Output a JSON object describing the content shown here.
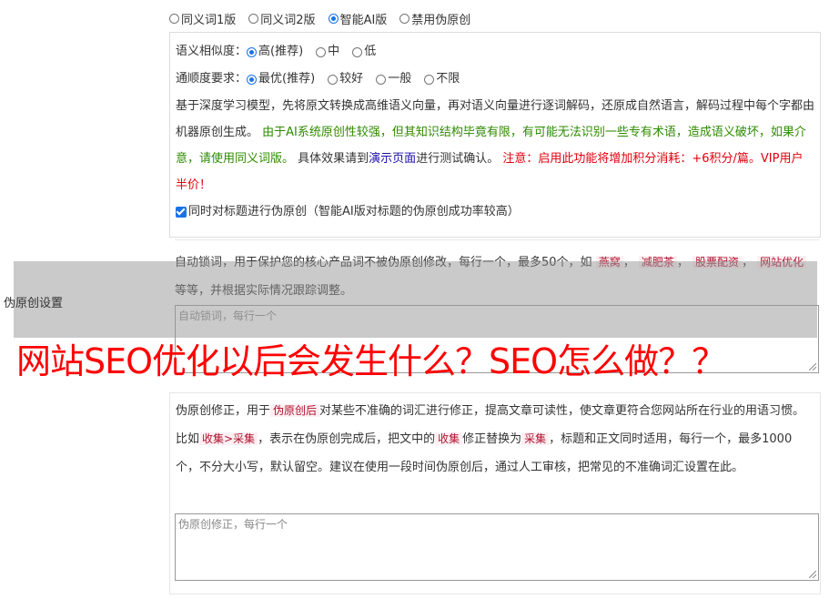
{
  "version_options": [
    {
      "label": "同义词1版",
      "checked": false
    },
    {
      "label": "同义词2版",
      "checked": false
    },
    {
      "label": "智能AI版",
      "checked": true
    },
    {
      "label": "禁用伪原创",
      "checked": false
    }
  ],
  "similarity": {
    "label": "语义相似度：",
    "options": [
      {
        "label": "高(推荐)",
        "checked": true
      },
      {
        "label": "中",
        "checked": false
      },
      {
        "label": "低",
        "checked": false
      }
    ]
  },
  "fluency": {
    "label": "通顺度要求：",
    "options": [
      {
        "label": "最优(推荐)",
        "checked": true
      },
      {
        "label": "较好",
        "checked": false
      },
      {
        "label": "一般",
        "checked": false
      },
      {
        "label": "不限",
        "checked": false
      }
    ]
  },
  "description": {
    "text1": "基于深度学习模型，先将原文转换成高维语义向量，再对语义向量进行逐词解码，还原成自然语言，解码过程中每个字都由机器原创生成。",
    "warn_green": "由于AI系统原创性较强，但其知识结构毕竟有限，有可能无法识别一些专有术语，造成语义破坏，如果介意，请使用同义词版。",
    "text2": "具体效果请到",
    "demo_link": "演示页面",
    "text3": "进行测试确认。",
    "warn_red": "注意：启用此功能将增加积分消耗：+6积分/篇。VIP用户半价！"
  },
  "title_checkbox": {
    "label": "同时对标题进行伪原创（智能AI版对标题的伪原创成功率较高）",
    "checked": true
  },
  "lock_words": {
    "text1": "自动锁词，用于保护您的核心产品词不被伪原创修改，每行一个，最多50个，如",
    "tags": [
      "燕窝",
      "减肥茶",
      "股票配资",
      "网站优化"
    ],
    "text2": "等等，并根据实际情况跟踪调整。",
    "placeholder": "自动锁词，每行一个"
  },
  "settings_label": "伪原创设置",
  "headline": "网站SEO优化以后会发生什么？SEO怎么做？？",
  "correction": {
    "text1": "伪原创修正，用于",
    "tag1": "伪原创后",
    "text2": "对某些不准确的词汇进行修正，提高文章可读性，使文章更符合您网站所在行业的用语习惯。比如",
    "tag2": "收集>采集",
    "text3": "，表示在伪原创完成后，把文中的",
    "tag3": "收集",
    "text4": "修正替换为",
    "tag4": "采集",
    "text5": "，标题和正文同时适用，每行一个，最多1000个，不分大小写，默认留空。建议在使用一段时间伪原创后，通过人工审核，把常见的不准确词汇设置在此。",
    "placeholder": "伪原创修正，每行一个"
  }
}
